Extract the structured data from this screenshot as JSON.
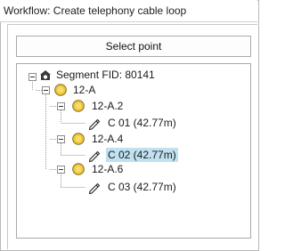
{
  "window": {
    "title": "Workflow: Create telephony cable loop"
  },
  "toolbar": {
    "select_point_label": "Select point"
  },
  "tree": {
    "root": {
      "label": "Segment FID: 80141",
      "icon": "segment-icon",
      "expanded": true
    },
    "node_12a": {
      "label": "12-A",
      "icon": "node-icon",
      "expanded": true
    },
    "a2": {
      "label": "12-A.2",
      "icon": "node-icon",
      "expanded": true
    },
    "c01": {
      "label": "C 01 (42.77m)",
      "icon": "cable-icon",
      "selected": false
    },
    "a4": {
      "label": "12-A.4",
      "icon": "node-icon",
      "expanded": true
    },
    "c02": {
      "label": "C 02 (42.77m)",
      "icon": "cable-icon",
      "selected": true
    },
    "a6": {
      "label": "12-A.6",
      "icon": "node-icon",
      "expanded": true
    },
    "c03": {
      "label": "C 03 (42.77m)",
      "icon": "cable-icon",
      "selected": false
    }
  },
  "colors": {
    "selection": "#bfe1f0",
    "node_fill": "#f2c633",
    "border": "#a9a9a9"
  }
}
